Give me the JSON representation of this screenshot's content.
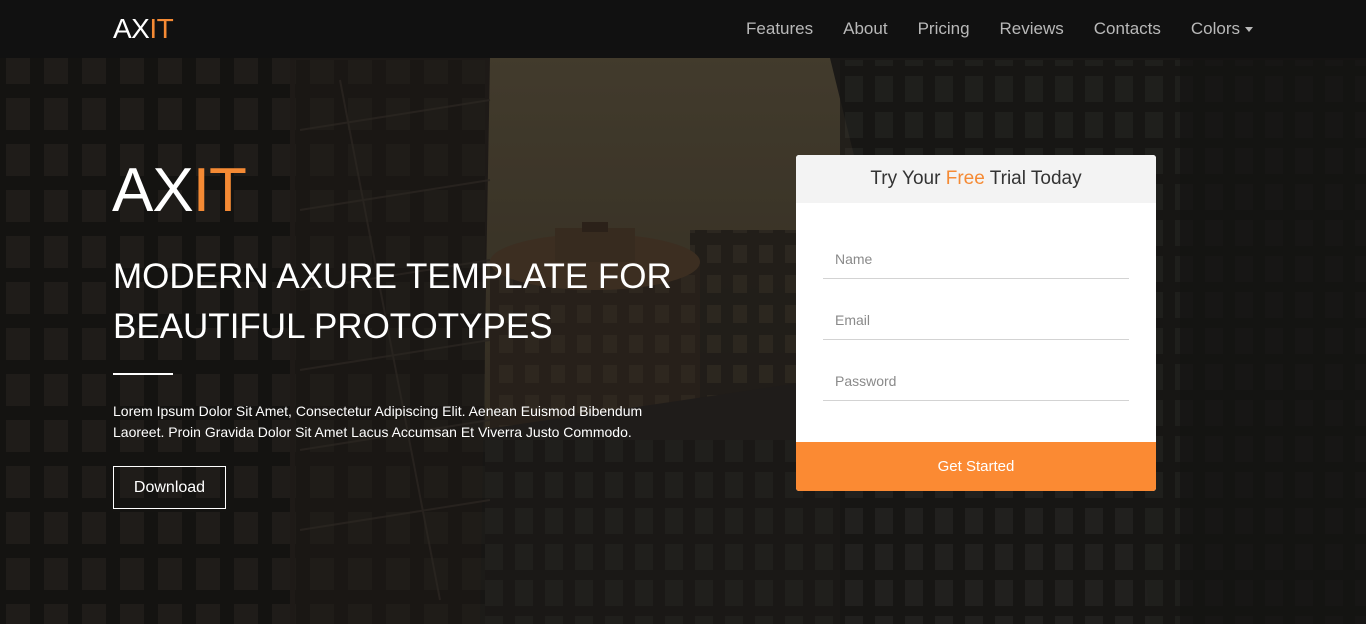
{
  "brand": {
    "prefix": "AX",
    "accent": "IT"
  },
  "nav": {
    "links": [
      "Features",
      "About",
      "Pricing",
      "Reviews",
      "Contacts"
    ],
    "dropdown_label": "Colors"
  },
  "hero": {
    "logo_prefix": "AX",
    "logo_accent": "IT",
    "title": "MODERN AXURE TEMPLATE FOR BEAUTIFUL PROTOTYPES",
    "text": "Lorem Ipsum Dolor Sit Amet, Consectetur Adipiscing Elit. Aenean Euismod Bibendum Laoreet. Proin Gravida Dolor Sit Amet Lacus Accumsan Et Viverra Justo Commodo.",
    "download_label": "Download"
  },
  "trial": {
    "title_before": "Try Your ",
    "title_accent": "Free",
    "title_after": " Trial Today",
    "name_placeholder": "Name",
    "email_placeholder": "Email",
    "password_placeholder": "Password",
    "submit_label": "Get Started"
  },
  "colors": {
    "accent": "#f58a34",
    "navbar": "#111111",
    "button": "#fb8a33"
  }
}
